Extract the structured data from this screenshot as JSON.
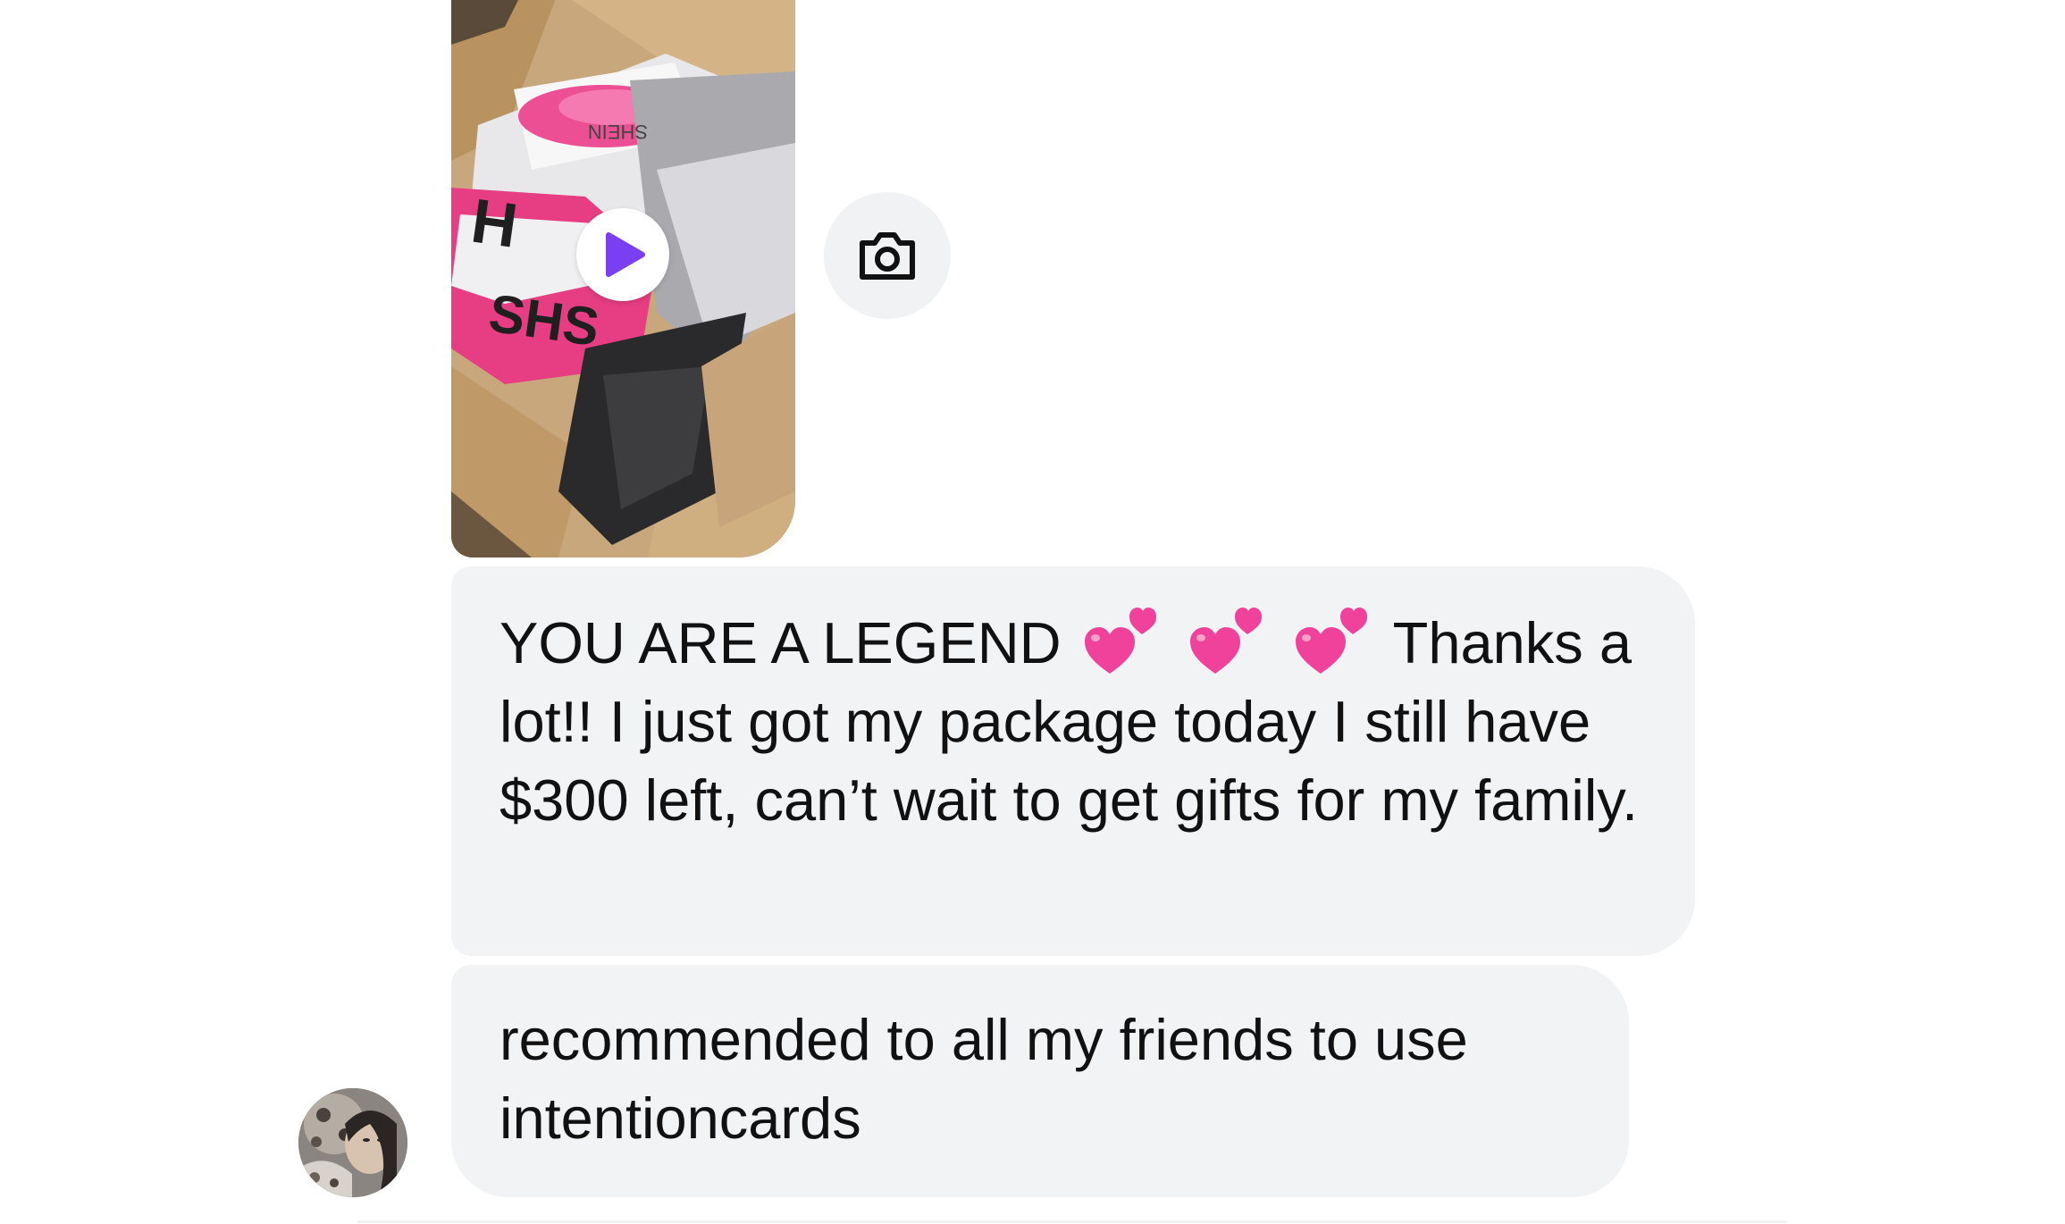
{
  "conversation": {
    "video_message": {
      "thumbnail_icon": "video-thumbnail",
      "play_icon": "play-icon",
      "play_color": "#7b3ff2"
    },
    "camera_button": {
      "icon": "camera-icon"
    },
    "messages": [
      {
        "text_before_emoji": "YOU ARE A LEGEND",
        "emoji": [
          "two-hearts-emoji",
          "two-hearts-emoji",
          "two-hearts-emoji"
        ],
        "text_after_emoji": "Thanks a lot!! I just got my package today I still have $300 left, can’t wait to get gifts for my family."
      },
      {
        "text": "recommended to all my friends to use intentioncards"
      }
    ],
    "sender_avatar": {
      "icon": "avatar"
    },
    "bubble_color": "#f2f3f5",
    "heart_color": "#f0419b"
  }
}
